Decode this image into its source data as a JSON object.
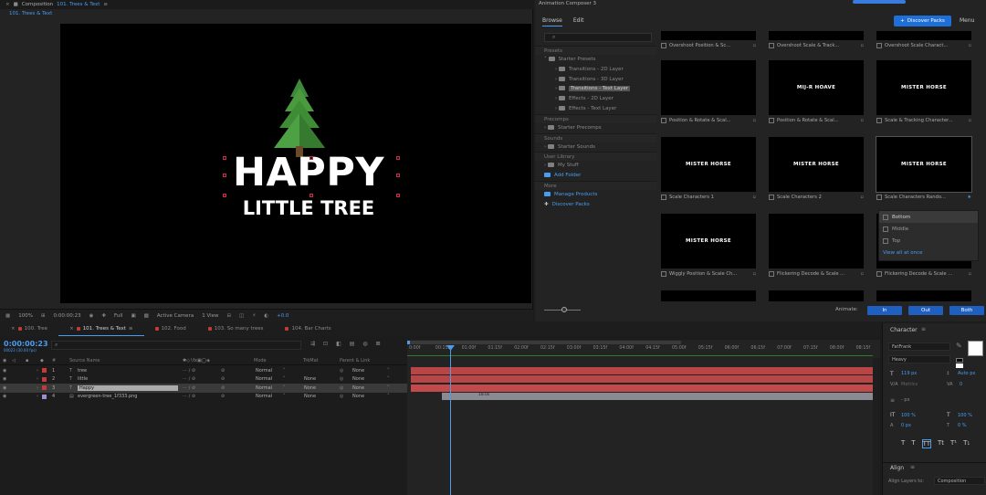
{
  "composition": {
    "header_title": "Composition",
    "header_comp": "101. Trees & Text",
    "tab_label": "101. Trees & Text",
    "canvas": {
      "line1": "HAPPY",
      "line2": "LITTLE TREE"
    },
    "viewer_bar": {
      "zoom": "100%",
      "timecode": "0:00:00:23",
      "resolution": "Full",
      "camera": "Active Camera",
      "views": "1 View",
      "exposure": "+0.0"
    }
  },
  "animation_composer": {
    "title": "Animation Composer 3",
    "tabs": [
      "Browse",
      "Edit"
    ],
    "discover_button": "Discover Packs",
    "menu": "Menu",
    "tree": {
      "presets_header": "Presets",
      "starter_presets": "Starter Presets",
      "preset_folders": [
        "Transitions - 2D Layer",
        "Transitions - 3D Layer",
        "Transitions - Text Layer",
        "Effects - 2D Layer",
        "Effects - Text Layer"
      ],
      "precomps_header": "Precomps",
      "starter_precomps": "Starter Precomps",
      "sounds_header": "Sounds",
      "starter_sounds": "Starter Sounds",
      "user_header": "User Library",
      "my_stuff": "My Stuff",
      "add_folder": "Add Folder",
      "more_header": "More",
      "manage_products": "Manage Products",
      "discover_packs": "Discover Packs"
    },
    "cards": [
      {
        "caption": "Overshoot Position & Sc...",
        "thumb": ""
      },
      {
        "caption": "Overshoot Scale & Track...",
        "thumb": ""
      },
      {
        "caption": "Overshoot Scale Charact...",
        "thumb": ""
      },
      {
        "caption": "Position & Rotate & Scal...",
        "thumb": ""
      },
      {
        "caption": "Position & Rotate & Scal...",
        "thumb": "MIJ-R HOAVE"
      },
      {
        "caption": "Scale & Tracking Character...",
        "thumb": "MISTER HORSE"
      },
      {
        "caption": "Scale Characters 1",
        "thumb": "MISTER HORSE"
      },
      {
        "caption": "Scale Characters 2",
        "thumb": "MISTER HORSE"
      },
      {
        "caption": "Scale Characters Rando...",
        "thumb": "MISTER HORSE"
      },
      {
        "caption": "Wiggly Position & Scale Ch...",
        "thumb": "MISTER HORSE"
      },
      {
        "caption": "Flickering Decode & Scale ...",
        "thumb": ""
      },
      {
        "caption": "Flickering Decode & Scale ...",
        "thumb": ""
      }
    ],
    "dropdown": {
      "options": [
        "Bottom",
        "Middle",
        "Top"
      ],
      "view_all": "View all at once"
    },
    "animate_label": "Animate:",
    "animate_buttons": [
      "In",
      "Out",
      "Both"
    ]
  },
  "timeline": {
    "tabs": [
      {
        "label": "100. Tree",
        "color": "#c23a3a"
      },
      {
        "label": "101. Trees & Text",
        "color": "#c23a3a"
      },
      {
        "label": "102. Food",
        "color": "#c23a3a"
      },
      {
        "label": "103. So many trees",
        "color": "#c23a3a"
      },
      {
        "label": "104. Bar Charts",
        "color": "#c23a3a"
      }
    ],
    "timecode": "0:00:00:23",
    "timecode_sub": "00023 (30.00 fps)",
    "columns": {
      "source_name": "Source Name",
      "mode": "Mode",
      "trkmat": "TrkMat",
      "parent": "Parent & Link"
    },
    "layers": [
      {
        "num": "1",
        "type": "T",
        "name": "tree",
        "mode": "Normal",
        "trkmat": "",
        "parent": "None",
        "color": "#c23a3a"
      },
      {
        "num": "2",
        "type": "T",
        "name": "little",
        "mode": "Normal",
        "trkmat": "None",
        "parent": "None",
        "color": "#c23a3a"
      },
      {
        "num": "3",
        "type": "T",
        "name": "Happy",
        "mode": "Normal",
        "trkmat": "None",
        "parent": "None",
        "color": "#c23a3a"
      },
      {
        "num": "4",
        "type": "img",
        "name": "evergreen-tree_1f333.png",
        "mode": "Normal",
        "trkmat": "None",
        "parent": "None",
        "color": "#9a8fcf"
      }
    ],
    "ruler": [
      "0:00f",
      "00:15f",
      "01:00f",
      "01:15f",
      "02:00f",
      "02:15f",
      "03:00f",
      "03:15f",
      "04:00f",
      "04:15f",
      "05:00f",
      "05:15f",
      "06:00f",
      "06:15f",
      "07:00f",
      "07:15f",
      "08:00f",
      "08:15f"
    ],
    "clip_label": "18.0s"
  },
  "character": {
    "title": "Character",
    "font": "FatFrank",
    "style": "Heavy",
    "size": "119 px",
    "leading": "Auto px",
    "kerning": "Metrics",
    "tracking": "0",
    "stroke": "- px",
    "vscale": "100 %",
    "hscale": "100 %",
    "baseline": "0 px",
    "tsume": "0 %",
    "align_title": "Align",
    "align_to_label": "Align Layers to:",
    "align_to": "Composition"
  }
}
